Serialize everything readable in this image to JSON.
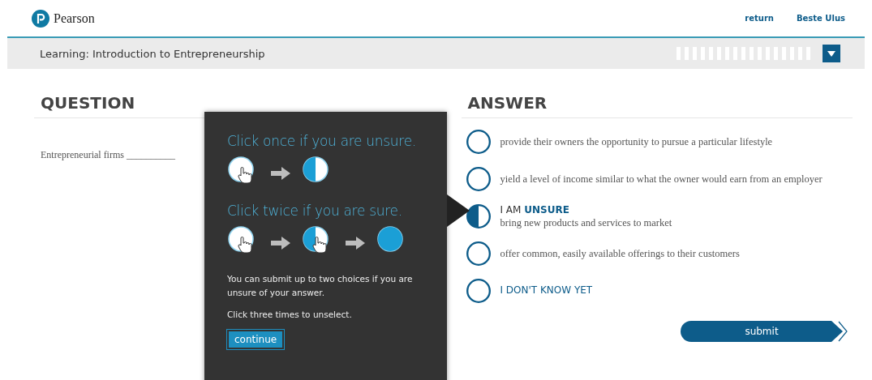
{
  "header": {
    "brand": "Pearson",
    "links": [
      "return",
      "Beste Ulus"
    ]
  },
  "course_bar": {
    "title": "Learning: Introduction to Entrepreneurship"
  },
  "question": {
    "heading": "QUESTION",
    "prompt": "Entrepreneurial firms __________"
  },
  "answer": {
    "heading": "ANSWER",
    "options": [
      {
        "unsure": false,
        "text": "provide their owners the opportunity to pursue a particular lifestyle"
      },
      {
        "unsure": false,
        "text": "yield a level of income similar to what the owner would earn from an employer"
      },
      {
        "unsure": true,
        "label": "I AM **UNSURE**",
        "text": "bring new products and services to market"
      },
      {
        "unsure": false,
        "text": "offer common, easily available offerings to their customers"
      },
      {
        "unsure": false,
        "kind": "dont_know",
        "text": "I DON'T KNOW YET"
      }
    ],
    "submit": "submit"
  },
  "tutorial": {
    "step_1": "Click once if you are unsure.",
    "step_2": "Click twice if you are sure.",
    "notes": [
      "You can submit up to two choices if you are unsure of your answer.",
      "Click three times to unselect."
    ],
    "button": "continue"
  }
}
